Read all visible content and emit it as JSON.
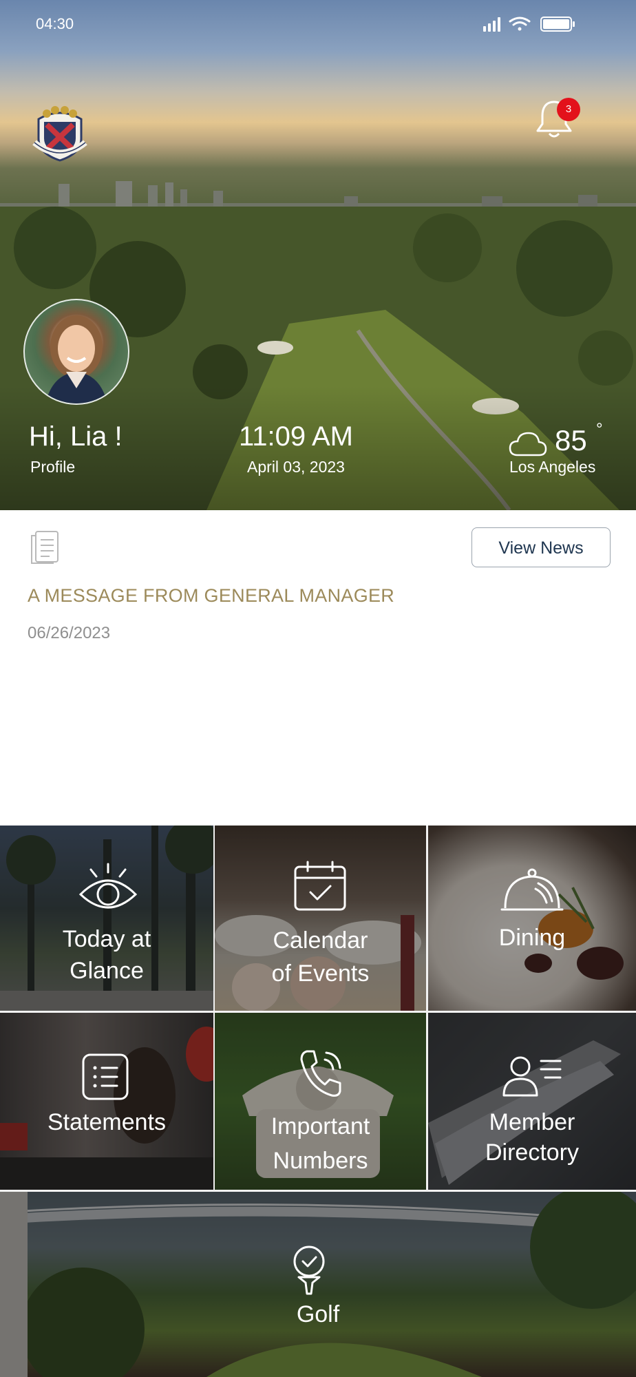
{
  "status_bar": {
    "time": "04:30"
  },
  "header": {
    "notification_count": "3"
  },
  "user": {
    "greeting": "Hi, Lia !",
    "profile_label": "Profile"
  },
  "clock": {
    "time": "11:09 AM",
    "date": "April 03, 2023"
  },
  "weather": {
    "temperature": "85",
    "degree_symbol": "°",
    "city": "Los Angeles"
  },
  "news": {
    "view_button": "View News",
    "title": "A MESSAGE FROM GENERAL MANAGER",
    "date": "06/26/2023"
  },
  "tiles": {
    "today": {
      "line1": "Today at",
      "line2": "Glance"
    },
    "calendar": {
      "line1": "Calendar",
      "line2": "of Events"
    },
    "dining": {
      "label": "Dining"
    },
    "statements": {
      "label": "Statements"
    },
    "numbers": {
      "line1": "Important",
      "line2": "Numbers"
    },
    "directory": {
      "line1": "Member",
      "line2": "Directory"
    },
    "golf": {
      "label": "Golf"
    }
  },
  "colors": {
    "accent_gold": "#9c8a5a",
    "badge_red": "#e3111b",
    "button_text": "#1f3650"
  }
}
